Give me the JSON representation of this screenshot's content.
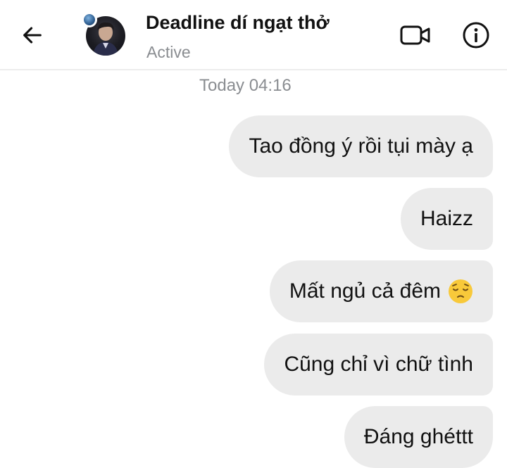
{
  "header": {
    "back_icon": "arrow-left-icon",
    "chat_name": "Deadline dí ngạt thở",
    "status": "Active",
    "video_icon": "video-camera-icon",
    "info_icon": "info-icon"
  },
  "timestamp": "Today 04:16",
  "messages": [
    {
      "text": "Tao đồng ý rồi tụi mày ạ"
    },
    {
      "text": "Haizz"
    },
    {
      "text": "Mất ngủ cả đêm",
      "emoji": "pensive-face-emoji"
    },
    {
      "text": "Cũng chỉ vì chữ tình"
    },
    {
      "text": "Đáng ghéttt"
    }
  ],
  "colors": {
    "bubble": "#ebebeb",
    "text": "#111111",
    "muted": "#8a8d91",
    "emoji": "#f8c93a"
  }
}
